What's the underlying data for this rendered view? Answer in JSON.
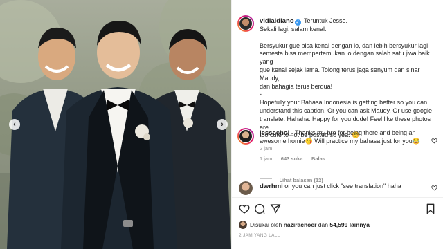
{
  "post": {
    "author": "vidialdiano",
    "caption_first_line": "Teruntuk Jesse.",
    "caption_lines": [
      "Sekali lagi, salam kenal.",
      "",
      "Bersyukur gue bisa kenal dengan lo, dan lebih bersyukur lagi",
      "semesta bisa mempertemukan lo dengan salah satu jiwa baik yang",
      "gue kenal sejak lama. Tolong terus jaga senyum dan sinar Maudy,",
      "dan bahagia terus berdua!",
      "-",
      "Hopefully your Bahasa Indonesia is getting better so you can",
      "understand this caption. Or you can ask Maudy. Or use google",
      "translate. Hahaha. Happy for you dude! Feel like these photos are",
      "too cute to not be posted so yea. 😊"
    ],
    "caption_time": "2 jam"
  },
  "comments": [
    {
      "username": "jessechoi_",
      "text_lines": [
        "Thanks my bro for being there and being an",
        "awesome homie😘 Will practice my bahasa just for you😂"
      ],
      "time": "1 jam",
      "likes": "643 suka",
      "reply": "Balas",
      "view_replies": "Lihat balasan (12)"
    },
    {
      "username": "dwrhmi",
      "text_lines": [
        "or you can just click \"see translation\" haha"
      ]
    }
  ],
  "liked_by": {
    "prefix": "Disukai oleh",
    "user": "naziracnoer",
    "conj": "dan",
    "count": "54,599 lainnya"
  },
  "post_time": "2 JAM YANG LALU",
  "nav": {
    "prev": "‹",
    "next": "›"
  },
  "icons": [
    "heart-icon",
    "comment-icon",
    "share-icon",
    "bookmark-icon",
    "verified-icon"
  ],
  "colors": {
    "verified": "#3897f0",
    "muted": "#8e8e8e",
    "text": "#262626"
  }
}
